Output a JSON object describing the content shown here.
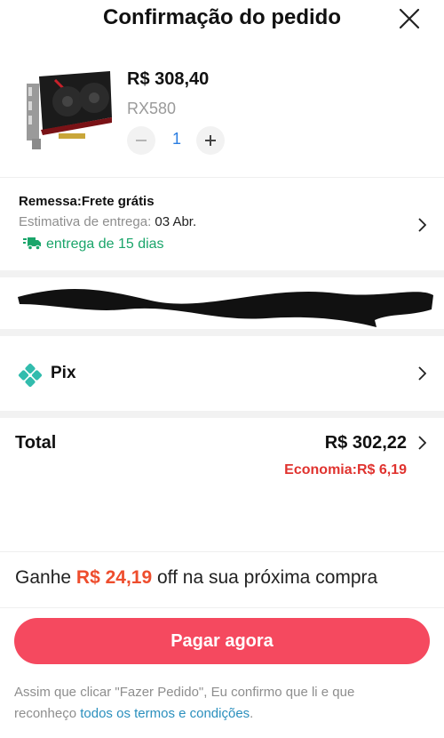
{
  "header": {
    "title": "Confirmação do pedido",
    "close_icon": "close-icon"
  },
  "product": {
    "image": "graphics-card-thumbnail",
    "price": "R$ 308,40",
    "variant": "RX580",
    "quantity": "1",
    "minus_icon": "minus-icon",
    "plus_icon": "plus-icon"
  },
  "shipping": {
    "label": "Remessa:Frete grátis",
    "estimate_prefix": "Estimativa de entrega:",
    "estimate_date": "03 Abr.",
    "delivery_days": "entrega de 15 dias",
    "truck_icon": "truck-icon",
    "accent": "#1aa56a"
  },
  "address": {
    "redacted": true
  },
  "payment": {
    "method": "Pix",
    "icon": "pix-icon",
    "accent": "#32bcad"
  },
  "total": {
    "label": "Total",
    "amount": "R$ 302,22",
    "savings": "Economia:R$ 6,19"
  },
  "promo": {
    "prefix": "Ganhe",
    "amount": "R$ 24,19",
    "suffix": "off na sua próxima compra"
  },
  "pay_button": {
    "label": "Pagar agora",
    "color": "#f5495f"
  },
  "terms": {
    "text_line1": "Assim que clicar \"Fazer Pedido\", Eu confirmo que li e que",
    "text_line2": "reconheço",
    "link": "todos os termos e condições",
    "end": "."
  }
}
